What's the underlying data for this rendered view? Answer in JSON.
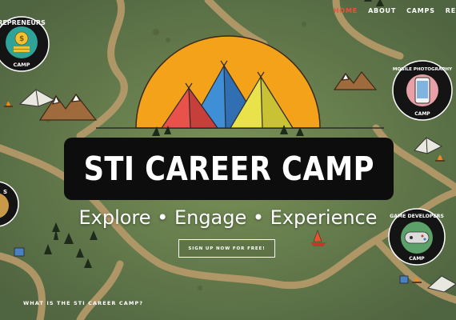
{
  "nav": {
    "items": [
      {
        "label": "HOME",
        "active": true
      },
      {
        "label": "ABOUT",
        "active": false
      },
      {
        "label": "CAMPS",
        "active": false
      },
      {
        "label": "RE",
        "active": false
      }
    ],
    "active_color": "#e8533a"
  },
  "hero": {
    "title": "STI CAREER CAMP",
    "tagline": "Explore • Engage • Experience",
    "cta_label": "SIGN UP NOW FOR FREE!"
  },
  "badges": {
    "entrepreneurs": {
      "label": "REPRENEURS",
      "sub": "CAMP"
    },
    "mobile_photography": {
      "label": "MOBILE PHOTOGRAPHY",
      "sub": "CAMP"
    },
    "game_developers": {
      "label": "GAME DEVELOPERS",
      "sub": "CAMP"
    }
  },
  "section": {
    "link": "WHAT IS THE STI CAREER CAMP?"
  },
  "colors": {
    "map_green": "#6f8752",
    "path": "#b89a6a",
    "sun": "#f5a21b",
    "tent_red": "#e8524a",
    "tent_blue": "#3f8fd6",
    "tent_yellow": "#e9e24a"
  }
}
